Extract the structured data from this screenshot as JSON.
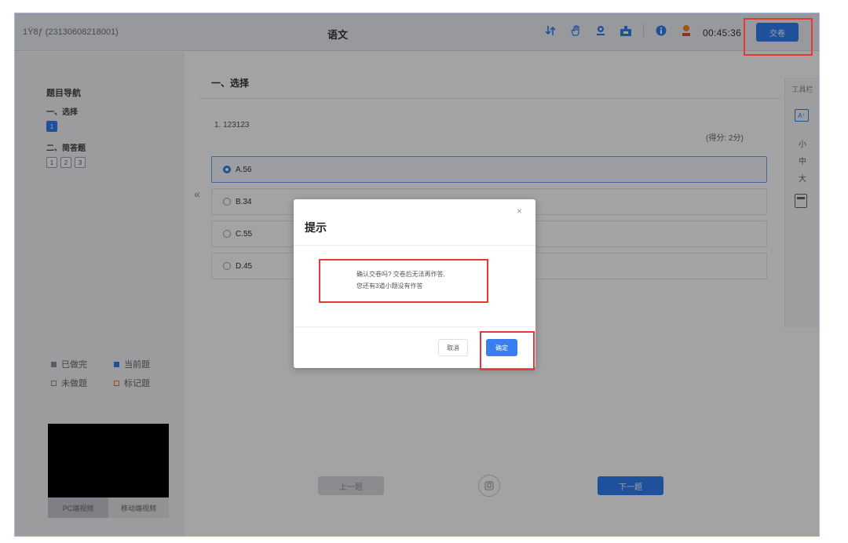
{
  "header": {
    "student": "1Ÿ8ƒ (23130608218001)",
    "subject": "语文",
    "tools": [
      "swap-icon",
      "hand-icon",
      "camera-icon",
      "raise-hand-icon",
      "info-icon",
      "user-icon"
    ],
    "timer": "00:45:36",
    "submit_label": "交卷"
  },
  "sidebar": {
    "nav_title": "题目导航",
    "section1": "一、选择",
    "section1_questions": [
      "1"
    ],
    "section2": "二、简答题",
    "section2_questions": [
      "1",
      "2",
      "3"
    ],
    "legend": {
      "done": "已做完",
      "current": "当前题",
      "undone": "未做题",
      "marked": "标记题"
    },
    "video_tabs": [
      "PC端视频",
      "移动端视频"
    ]
  },
  "main": {
    "collapse": "«",
    "section_title": "一、选择",
    "question": "1. 123123",
    "score": "(得分: 2分)",
    "options": [
      "A.56",
      "B.34",
      "C.55",
      "D.45"
    ],
    "prev_label": "上一题",
    "next_label": "下一题"
  },
  "toolbar": {
    "label": "工具栏",
    "sizes": [
      "小",
      "中",
      "大"
    ]
  },
  "modal": {
    "title": "提示",
    "close": "×",
    "message_line1": "确认交卷吗? 交卷后无法再作答,",
    "message_line2": "您还有3道小题没有作答",
    "cancel_label": "取消",
    "confirm_label": "确定"
  },
  "colors": {
    "accent": "#2f7df4",
    "highlight": "#e53935"
  }
}
